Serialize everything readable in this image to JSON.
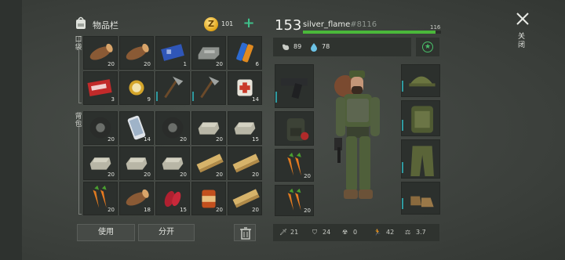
{
  "inventory": {
    "title": "物品栏",
    "coins": "101",
    "add_label": "+",
    "backpack_section_label": "口袋",
    "bag_section_label": "背包",
    "use_button": "使用",
    "split_button": "分开"
  },
  "pocket_slots": [
    {
      "icon": "log-icon",
      "count": "20"
    },
    {
      "icon": "log-icon",
      "count": "20"
    },
    {
      "icon": "circuit-board-icon",
      "count": "1"
    },
    {
      "icon": "metal-ingot-icon",
      "count": "20"
    },
    {
      "icon": "battery-icon",
      "count": "6"
    },
    {
      "icon": "coupon-icon",
      "count": "3"
    },
    {
      "icon": "gold-watch-icon",
      "count": "9"
    },
    {
      "icon": "hatchet-icon",
      "count": ""
    },
    {
      "icon": "hatchet-icon",
      "count": ""
    },
    {
      "icon": "medkit-icon",
      "count": "14"
    }
  ],
  "bag_slots": [
    {
      "icon": "tire-icon",
      "count": "20"
    },
    {
      "icon": "smartphone-icon",
      "count": "14"
    },
    {
      "icon": "tire-icon",
      "count": "20"
    },
    {
      "icon": "stone-icon",
      "count": "20"
    },
    {
      "icon": "stone-icon",
      "count": "15"
    },
    {
      "icon": "stone-icon",
      "count": "20"
    },
    {
      "icon": "stone-icon",
      "count": "20"
    },
    {
      "icon": "stone-icon",
      "count": "20"
    },
    {
      "icon": "plank-icon",
      "count": "20"
    },
    {
      "icon": "plank-icon",
      "count": "20"
    },
    {
      "icon": "carrot-icon",
      "count": "20"
    },
    {
      "icon": "log-icon",
      "count": "18"
    },
    {
      "icon": "raw-meat-icon",
      "count": "15"
    },
    {
      "icon": "canned-food-icon",
      "count": "20"
    },
    {
      "icon": "plank-icon",
      "count": "20"
    }
  ],
  "character": {
    "level": "153",
    "username": "silver_flame",
    "tag": "#8116",
    "xp_value": "116",
    "xp_progress": 0.96,
    "hunger": "89",
    "thirst": "78",
    "close_label": "关闭"
  },
  "equipment_left": [
    {
      "icon": "pistol-icon",
      "count": ""
    },
    {
      "icon": "backpack-icon",
      "count": ""
    },
    {
      "icon": "carrot-icon",
      "count": "20"
    },
    {
      "icon": "carrot-icon",
      "count": "20"
    }
  ],
  "equipment_right": [
    {
      "icon": "cap-icon"
    },
    {
      "icon": "body-armor-icon"
    },
    {
      "icon": "pants-icon"
    },
    {
      "icon": "boots-icon"
    }
  ],
  "combat_stats": {
    "attack": "21",
    "defense": "24",
    "radiation": "0",
    "speed": "42",
    "weight": "3.7"
  },
  "colors": {
    "accent_green": "#4ab83a",
    "accent_teal": "#2f9aa0",
    "coin_gold": "#e0a317"
  }
}
